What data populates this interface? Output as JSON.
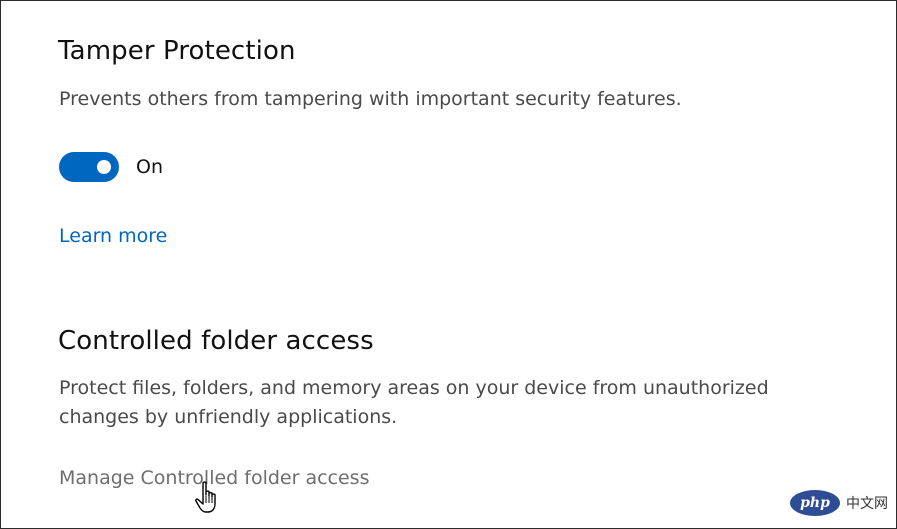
{
  "tamper": {
    "title": "Tamper Protection",
    "description": "Prevents others from tampering with important security features.",
    "toggle_state": "On",
    "toggle_on": true,
    "learn_more": "Learn more"
  },
  "cfa": {
    "title": "Controlled folder access",
    "description_line1": "Protect files, folders, and memory areas on your device from unauthorized",
    "description_line2": "changes by unfriendly applications.",
    "manage_link": "Manage Controlled folder access"
  },
  "watermark": {
    "logo": "php",
    "site": "中文网"
  },
  "colors": {
    "accent": "#0067c0",
    "muted_link": "#6e6e6e"
  }
}
